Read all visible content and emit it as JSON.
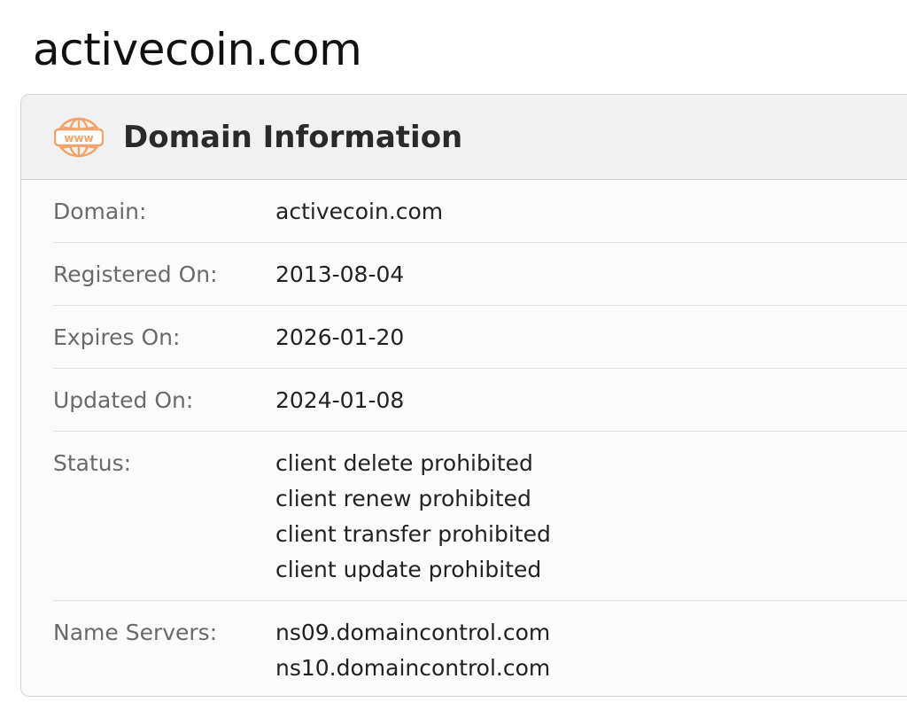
{
  "page": {
    "title": "activecoin.com"
  },
  "card": {
    "icon": "www-globe-icon",
    "accent_color": "#f2a36b",
    "title": "Domain Information"
  },
  "rows": [
    {
      "label": "Domain:",
      "values": [
        "activecoin.com"
      ]
    },
    {
      "label": "Registered On:",
      "values": [
        "2013-08-04"
      ]
    },
    {
      "label": "Expires On:",
      "values": [
        "2026-01-20"
      ]
    },
    {
      "label": "Updated On:",
      "values": [
        "2024-01-08"
      ]
    },
    {
      "label": "Status:",
      "values": [
        "client delete prohibited",
        "client renew prohibited",
        "client transfer prohibited",
        "client update prohibited"
      ]
    },
    {
      "label": "Name Servers:",
      "values": [
        "ns09.domaincontrol.com",
        "ns10.domaincontrol.com"
      ]
    }
  ]
}
